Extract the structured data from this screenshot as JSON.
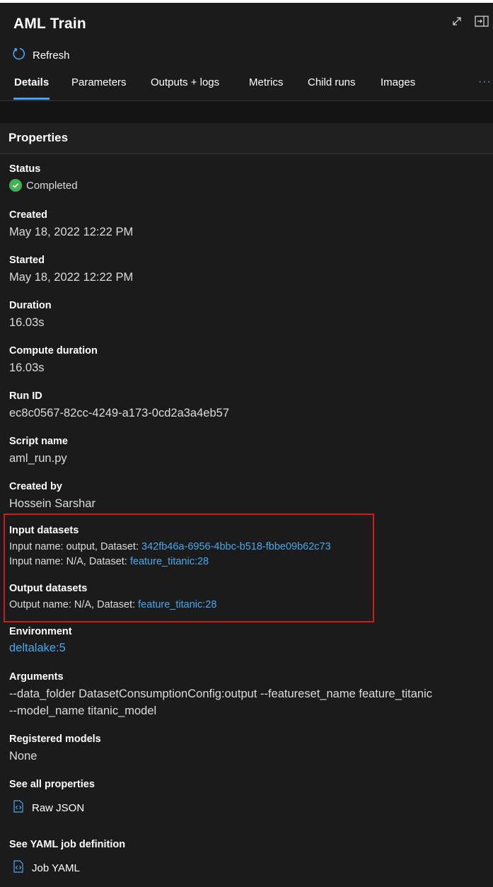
{
  "header": {
    "title": "AML Train",
    "refresh_label": "Refresh"
  },
  "tabs": [
    {
      "label": "Details"
    },
    {
      "label": "Parameters"
    },
    {
      "label": "Outputs + logs"
    },
    {
      "label": "Metrics"
    },
    {
      "label": "Child runs"
    },
    {
      "label": "Images"
    }
  ],
  "tab_more": "···",
  "properties": {
    "heading": "Properties",
    "status": {
      "label": "Status",
      "value": "Completed"
    },
    "created": {
      "label": "Created",
      "value": "May 18, 2022 12:22 PM"
    },
    "started": {
      "label": "Started",
      "value": "May 18, 2022 12:22 PM"
    },
    "duration": {
      "label": "Duration",
      "value": "16.03s"
    },
    "compute_duration": {
      "label": "Compute duration",
      "value": "16.03s"
    },
    "run_id": {
      "label": "Run ID",
      "value": "ec8c0567-82cc-4249-a173-0cd2a3a4eb57"
    },
    "script_name": {
      "label": "Script name",
      "value": "aml_run.py"
    },
    "created_by": {
      "label": "Created by",
      "value": "Hossein Sarshar"
    },
    "input_datasets": {
      "label": "Input datasets",
      "rows": [
        {
          "prefix": "Input name: output, Dataset: ",
          "link": "342fb46a-6956-4bbc-b518-fbbe09b62c73"
        },
        {
          "prefix": "Input name: N/A, Dataset: ",
          "link": "feature_titanic:28"
        }
      ]
    },
    "output_datasets": {
      "label": "Output datasets",
      "rows": [
        {
          "prefix": "Output name: N/A, Dataset: ",
          "link": "feature_titanic:28"
        }
      ]
    },
    "environment": {
      "label": "Environment",
      "value": "deltalake:5"
    },
    "arguments": {
      "label": "Arguments",
      "line1": "--data_folder DatasetConsumptionConfig:output --featureset_name feature_titanic",
      "line2": "--model_name titanic_model"
    },
    "registered_models": {
      "label": "Registered models",
      "value": "None"
    },
    "see_all_properties": {
      "label": "See all properties",
      "link": "Raw JSON"
    },
    "see_yaml": {
      "label": "See YAML job definition",
      "link": "Job YAML"
    }
  },
  "colors": {
    "accent": "#4aa8ec",
    "success": "#3fb34f",
    "highlight": "#d11a1a",
    "background": "#1b1b1b"
  }
}
